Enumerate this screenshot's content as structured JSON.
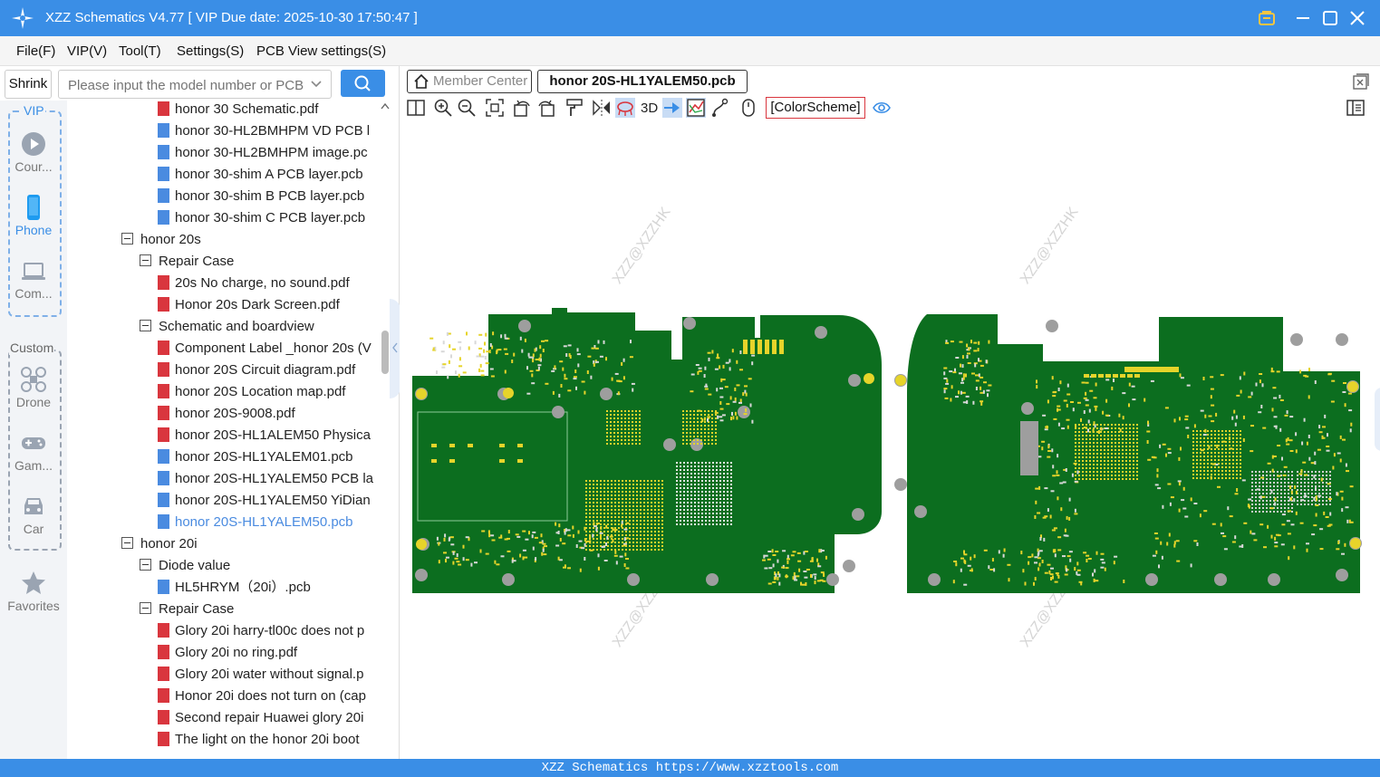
{
  "window": {
    "title": "XZZ Schematics V4.77 [ VIP Due date: 2025-10-30 17:50:47 ]"
  },
  "menu": [
    "File(F)",
    "VIP(V)",
    "Tool(T)",
    "Settings(S)",
    "PCB View settings(S)"
  ],
  "search": {
    "shrink_label": "Shrink",
    "placeholder": "Please input the model number or PCB"
  },
  "sidebar": {
    "vip_label": "VIP",
    "custom_label": "Custom",
    "vip_items": [
      {
        "label": "Cour...",
        "icon": "play-circle-icon"
      },
      {
        "label": "Phone",
        "icon": "phone-icon"
      },
      {
        "label": "Com...",
        "icon": "laptop-icon"
      }
    ],
    "custom_items": [
      {
        "label": "Drone",
        "icon": "drone-icon"
      },
      {
        "label": "Gam...",
        "icon": "gamepad-icon"
      },
      {
        "label": "Car",
        "icon": "car-icon"
      }
    ],
    "favorites_label": "Favorites"
  },
  "tree": [
    {
      "label": "honor 30 Schematic.pdf",
      "type": "pdf",
      "level": 2
    },
    {
      "label": "honor 30-HL2BMHPM VD PCB l",
      "type": "pcb",
      "level": 2
    },
    {
      "label": "honor 30-HL2BMHPM image.pc",
      "type": "pcb",
      "level": 2
    },
    {
      "label": "honor 30-shim A PCB layer.pcb",
      "type": "pcb",
      "level": 2
    },
    {
      "label": "honor 30-shim B PCB layer.pcb",
      "type": "pcb",
      "level": 2
    },
    {
      "label": "honor 30-shim C PCB layer.pcb",
      "type": "pcb",
      "level": 2
    },
    {
      "label": "honor 20s",
      "type": "folder",
      "level": 0
    },
    {
      "label": "Repair Case",
      "type": "folder",
      "level": 1
    },
    {
      "label": "20s No charge, no sound.pdf",
      "type": "pdf",
      "level": 2
    },
    {
      "label": "Honor 20s Dark Screen.pdf",
      "type": "pdf",
      "level": 2
    },
    {
      "label": "Schematic and boardview",
      "type": "folder",
      "level": 1
    },
    {
      "label": "Component Label _honor 20s (V",
      "type": "pdf",
      "level": 2
    },
    {
      "label": "honor 20S Circuit diagram.pdf",
      "type": "pdf",
      "level": 2
    },
    {
      "label": "honor 20S Location map.pdf",
      "type": "pdf",
      "level": 2
    },
    {
      "label": "honor 20S-9008.pdf",
      "type": "pdf",
      "level": 2
    },
    {
      "label": "honor 20S-HL1ALEM50 Physica",
      "type": "pdf",
      "level": 2
    },
    {
      "label": "honor 20S-HL1YALEM01.pcb",
      "type": "pcb",
      "level": 2
    },
    {
      "label": "honor 20S-HL1YALEM50 PCB la",
      "type": "pcb",
      "level": 2
    },
    {
      "label": "honor 20S-HL1YALEM50 YiDian",
      "type": "pcb",
      "level": 2
    },
    {
      "label": "honor 20S-HL1YALEM50.pcb",
      "type": "pcb",
      "level": 2,
      "selected": true
    },
    {
      "label": "honor 20i",
      "type": "folder",
      "level": 0
    },
    {
      "label": "Diode value",
      "type": "folder",
      "level": 1
    },
    {
      "label": "HL5HRYM（20i）.pcb",
      "type": "pcb",
      "level": 2
    },
    {
      "label": "Repair Case",
      "type": "folder",
      "level": 1
    },
    {
      "label": "Glory 20i harry-tl00c does not p",
      "type": "pdf",
      "level": 2
    },
    {
      "label": "Glory 20i no ring.pdf",
      "type": "pdf",
      "level": 2
    },
    {
      "label": "Glory 20i water without signal.p",
      "type": "pdf",
      "level": 2
    },
    {
      "label": "Honor 20i does not turn on (cap",
      "type": "pdf",
      "level": 2
    },
    {
      "label": "Second repair Huawei glory 20i",
      "type": "pdf",
      "level": 2
    },
    {
      "label": "The light on the honor 20i boot",
      "type": "pdf",
      "level": 2
    }
  ],
  "tabs": {
    "member_center": "Member Center",
    "active_file": "honor 20S-HL1YALEM50.pcb"
  },
  "toolbar": {
    "label_3d": "3D",
    "color_scheme": "[ColorScheme]"
  },
  "canvas": {
    "watermark": "XZZ@XZZHK",
    "board_color": "#0c6e1f",
    "pad_color": "#e6d42a"
  },
  "status": {
    "text": "XZZ Schematics https://www.xzztools.com"
  },
  "colors": {
    "accent": "#3a8ee6",
    "pdf_icon": "#d9363e",
    "pcb_icon": "#4a8be0"
  }
}
